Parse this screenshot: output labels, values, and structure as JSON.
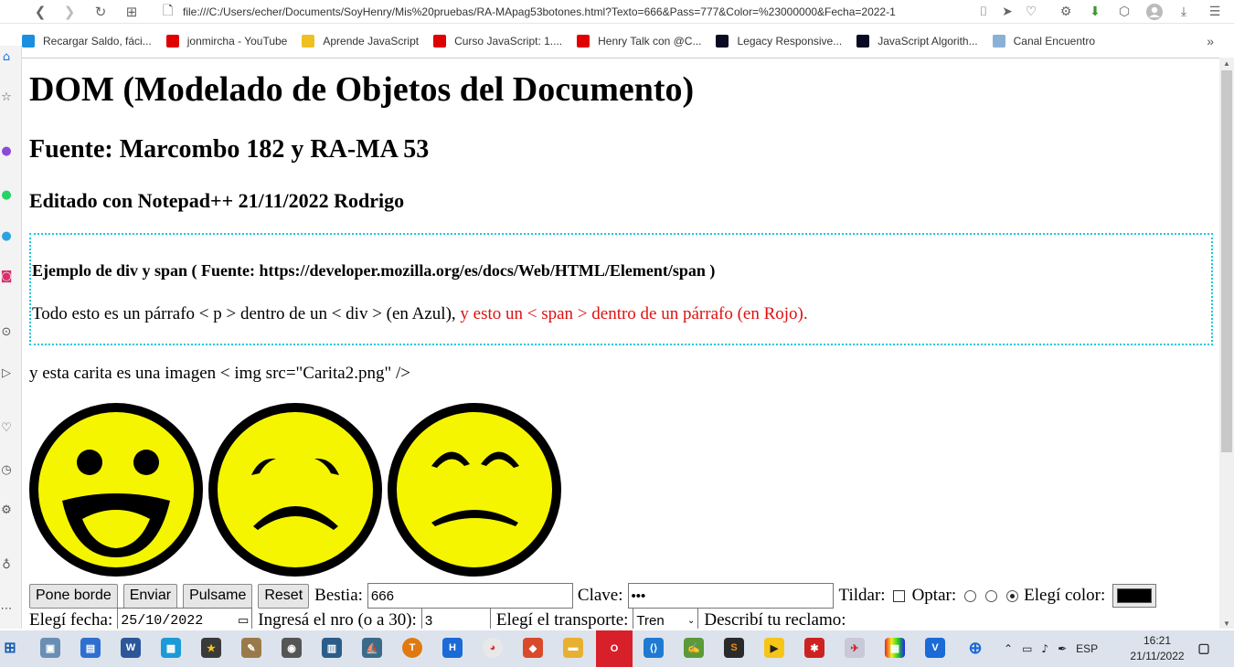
{
  "browser": {
    "url": "file:///C:/Users/echer/Documents/SoyHenry/Mis%20pruebas/RA-MApag53botones.html?Texto=666&Pass=777&Color=%23000000&Fecha=2022-1",
    "bookmarks": [
      {
        "label": "Recargar Saldo, fáci...",
        "icon": "recharge-icon",
        "color": "#1a8fe0"
      },
      {
        "label": "jonmircha - YouTube",
        "icon": "youtube-icon",
        "color": "#e00000"
      },
      {
        "label": "Aprende JavaScript",
        "icon": "js-icon",
        "color": "#f0c020"
      },
      {
        "label": "Curso JavaScript: 1....",
        "icon": "youtube-icon",
        "color": "#e00000"
      },
      {
        "label": "Henry Talk con @C...",
        "icon": "youtube-icon",
        "color": "#e00000"
      },
      {
        "label": "Legacy Responsive...",
        "icon": "freecodecamp-icon",
        "color": "#0a0a23"
      },
      {
        "label": "JavaScript Algorith...",
        "icon": "freecodecamp-icon",
        "color": "#0a0a23"
      },
      {
        "label": "Canal Encuentro",
        "icon": "encuentro-icon",
        "color": "#8ab0d8"
      }
    ]
  },
  "page": {
    "h1": "DOM (Modelado de Objetos del Documento)",
    "h2": "Fuente: Marcombo 182 y RA-MA 53",
    "h3": "Editado con Notepad++ 21/11/2022 Rodrigo",
    "div_title": "Ejemplo de div y span ( Fuente: https://developer.mozilla.org/es/docs/Web/HTML/Element/span )",
    "para_blue": "Todo esto es un párrafo < p > dentro de un < div > (en Azul), ",
    "span_red": "y esto un < span > dentro de un párrafo (en Rojo).",
    "img_caption": "y esta carita es una imagen < img src=\"Carita2.png\" />",
    "faces": [
      "happy-face",
      "sad-face",
      "worried-face"
    ],
    "colors": {
      "face_fill": "#f5f500",
      "face_outline": "#000000",
      "div_border": "#18c8dc",
      "span_text": "#e01010"
    }
  },
  "form": {
    "btn_borde": "Pone borde",
    "btn_enviar": "Enviar",
    "btn_pulsame": "Pulsame",
    "btn_reset": "Reset",
    "lbl_bestia": "Bestia:",
    "val_bestia": "666",
    "lbl_clave": "Clave:",
    "val_clave": "•••",
    "lbl_tildar": "Tildar:",
    "lbl_optar": "Optar:",
    "lbl_color": "Elegí color:",
    "color_value": "#000000",
    "lbl_fecha": "Elegí fecha:",
    "val_fecha": "25/10/2022",
    "lbl_nro": "Ingresá el nro (o a 30):",
    "val_nro": "3",
    "lbl_transporte": "Elegí el transporte:",
    "val_transporte": "Tren",
    "lbl_reclamo": "Describí tu reclamo:"
  },
  "taskbar": {
    "lang": "ESP",
    "time": "16:21",
    "date": "21/11/2022"
  }
}
